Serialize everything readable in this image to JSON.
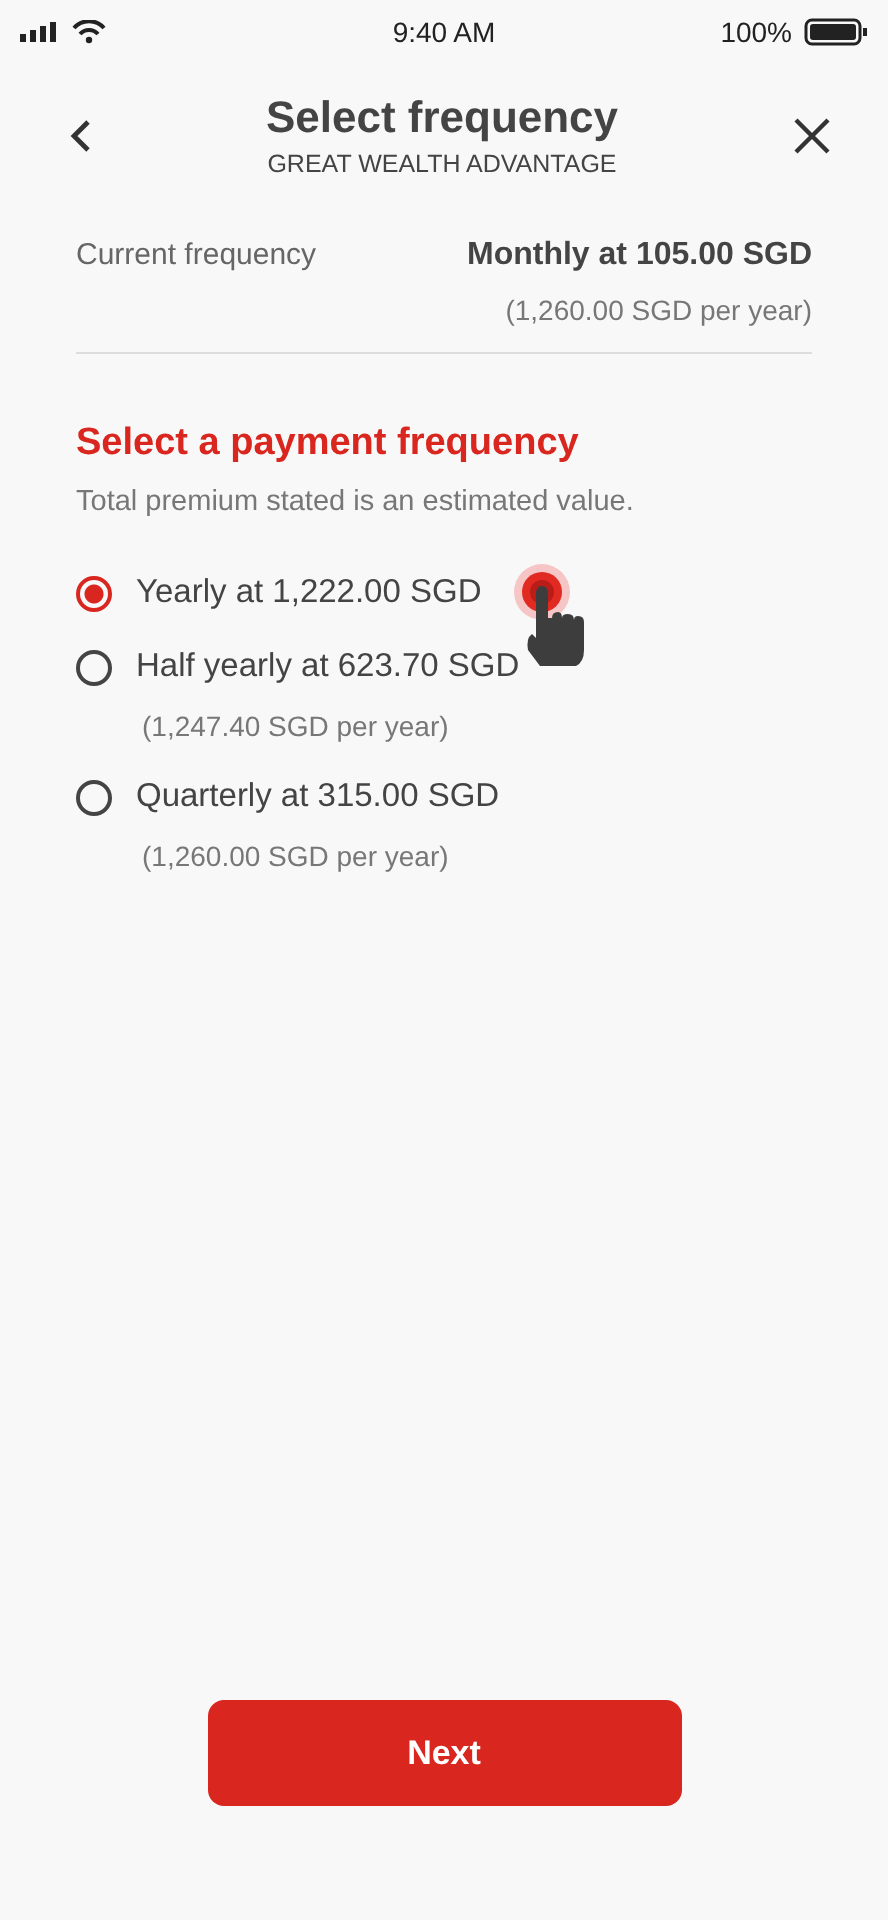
{
  "status_bar": {
    "time": "9:40 AM",
    "battery": "100%"
  },
  "header": {
    "title": "Select frequency",
    "subtitle": "GREAT WEALTH ADVANTAGE"
  },
  "current": {
    "label": "Current frequency",
    "value": "Monthly at 105.00 SGD",
    "note": "(1,260.00 SGD per year)"
  },
  "section": {
    "title": "Select a payment frequency",
    "note": "Total premium stated is an estimated value."
  },
  "options": [
    {
      "label": "Yearly at 1,222.00 SGD",
      "selected": true
    },
    {
      "label": "Half yearly at 623.70 SGD",
      "note": "(1,247.40 SGD per year)",
      "selected": false
    },
    {
      "label": "Quarterly at 315.00 SGD",
      "note": "(1,260.00 SGD per year)",
      "selected": false
    }
  ],
  "button": "Next"
}
